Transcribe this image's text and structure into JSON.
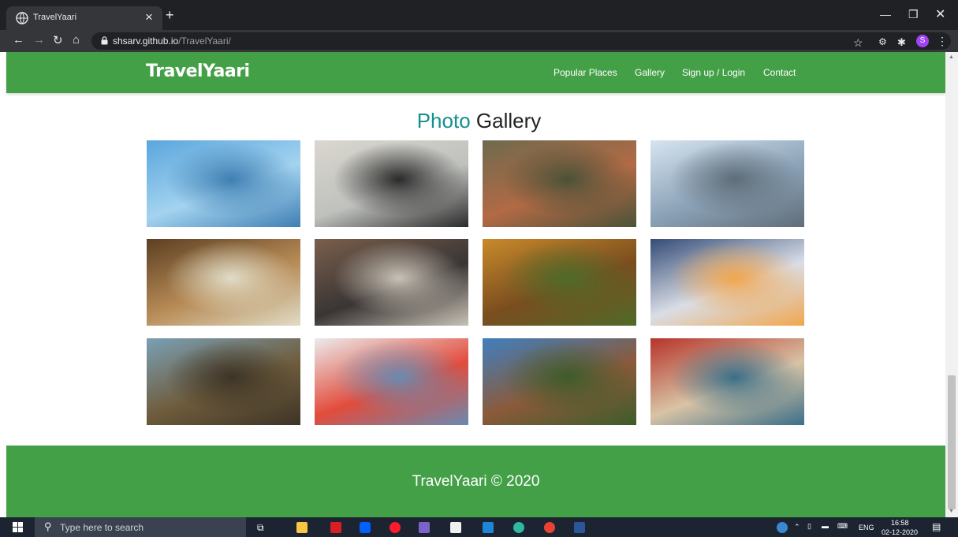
{
  "browser": {
    "tab_title": "TravelYaari",
    "url_host": "shsarv.github.io",
    "url_path": "/TravelYaari/",
    "profile_initial": "S"
  },
  "navbar": {
    "brand": "TravelYaari",
    "links": [
      "Popular Places",
      "Gallery",
      "Sign up / Login",
      "Contact"
    ]
  },
  "gallery": {
    "title_accent": "Photo",
    "title_rest": "Gallery",
    "photos": [
      {
        "name": "child-at-beach-photo",
        "colors": [
          "#5aa6dd",
          "#a3d3ef",
          "#3f7fb3"
        ]
      },
      {
        "name": "map-compass-camera-photo",
        "colors": [
          "#dad7cf",
          "#bfc1bd",
          "#2b2b2b"
        ]
      },
      {
        "name": "aerial-old-town-photo",
        "colors": [
          "#6e6a4e",
          "#b26a45",
          "#4b5238"
        ]
      },
      {
        "name": "woman-walking-on-reflective-beach-photo",
        "colors": [
          "#d6e4f0",
          "#8ca3b8",
          "#5f6d78"
        ]
      },
      {
        "name": "cave-waterfall-photo",
        "colors": [
          "#5c3f22",
          "#b88c57",
          "#e0dcc7"
        ]
      },
      {
        "name": "industrial-hangar-photo",
        "colors": [
          "#7a5f4c",
          "#3a3534",
          "#c8c1b5"
        ]
      },
      {
        "name": "autumn-forest-path-photo",
        "colors": [
          "#c98a2b",
          "#7a4d1f",
          "#4f6b28"
        ]
      },
      {
        "name": "ferry-in-mist-photo",
        "colors": [
          "#344c78",
          "#d9dde5",
          "#f1a64e"
        ]
      },
      {
        "name": "vintage-surveyors-photo",
        "colors": [
          "#7aa0b5",
          "#6f5c3c",
          "#3d3426"
        ]
      },
      {
        "name": "person-in-red-top-and-denim-shorts-photo",
        "colors": [
          "#ebebeb",
          "#e24c3c",
          "#6a8ab0"
        ]
      },
      {
        "name": "stone-aqueduct-arches-photo",
        "colors": [
          "#3f7fc0",
          "#8b5a3a",
          "#3d5c2b"
        ]
      },
      {
        "name": "venice-canal-photo",
        "colors": [
          "#b7342a",
          "#d8c3a5",
          "#3b6f88"
        ]
      }
    ]
  },
  "footer": {
    "text": "TravelYaari © 2020"
  },
  "taskbar": {
    "search_placeholder": "Type here to search",
    "language": "ENG",
    "time": "16:58",
    "date": "02-12-2020"
  },
  "colors": {
    "brand_green": "#43a047",
    "title_accent": "#138f8f"
  }
}
